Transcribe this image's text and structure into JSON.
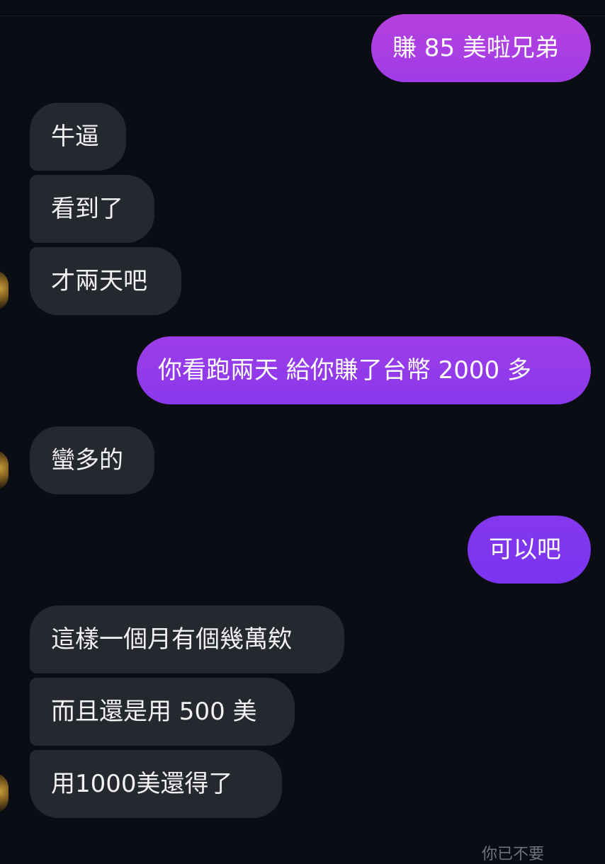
{
  "messages": [
    {
      "text": "賺 85 美啦兄弟",
      "sender": "me"
    },
    {
      "text": "牛逼",
      "sender": "them"
    },
    {
      "text": "看到了",
      "sender": "them"
    },
    {
      "text": "才兩天吧",
      "sender": "them"
    },
    {
      "text": "你看跑兩天 給你賺了台幣 2000 多",
      "sender": "me"
    },
    {
      "text": "蠻多的",
      "sender": "them"
    },
    {
      "text": "可以吧",
      "sender": "me"
    },
    {
      "text": "這樣一個月有個幾萬欸",
      "sender": "them"
    },
    {
      "text": "而且還是用 500 美",
      "sender": "them"
    },
    {
      "text": "用1000美還得了",
      "sender": "them"
    }
  ],
  "footer": {
    "partial_text": "你已不要"
  },
  "colors": {
    "background": "#0b0d14",
    "incoming_bubble": "#262830",
    "outgoing_gradient_top": "#b43fe0",
    "outgoing_gradient_bottom": "#7a35f0"
  },
  "icons": {
    "avatar": "contact-avatar"
  }
}
